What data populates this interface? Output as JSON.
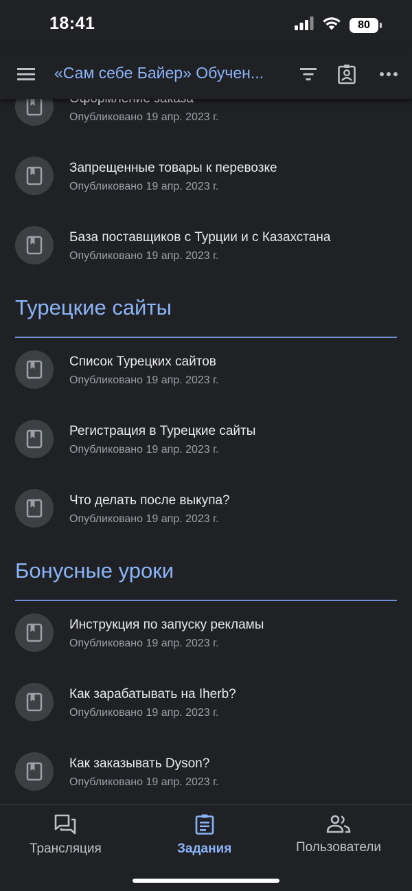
{
  "status_bar": {
    "time": "18:41",
    "battery": "80"
  },
  "app_bar": {
    "title": "«Сам себе Байер» Обучен...",
    "icons": [
      "menu-icon",
      "filter-icon",
      "assignment-ind-icon",
      "more-horiz-icon"
    ]
  },
  "feed": [
    {
      "kind": "item",
      "title": "Оформление заказа",
      "meta": "Опубликовано 19 апр. 2023 г."
    },
    {
      "kind": "item",
      "title": "Запрещенные товары к перевозке",
      "meta": "Опубликовано 19 апр. 2023 г."
    },
    {
      "kind": "item",
      "title": "База поставщиков с Турции и с Казахстана",
      "meta": "Опубликовано 19 апр. 2023 г."
    },
    {
      "kind": "section",
      "title": "Турецкие сайты"
    },
    {
      "kind": "item",
      "title": "Список Турецких сайтов",
      "meta": "Опубликовано 19 апр. 2023 г."
    },
    {
      "kind": "item",
      "title": "Регистрация в Турецкие сайты",
      "meta": "Опубликовано 19 апр. 2023 г."
    },
    {
      "kind": "item",
      "title": "Что делать после выкупа?",
      "meta": "Опубликовано 19 апр. 2023 г."
    },
    {
      "kind": "section",
      "title": "Бонусные уроки"
    },
    {
      "kind": "item",
      "title": "Инструкция по запуску рекламы",
      "meta": "Опубликовано 19 апр. 2023 г."
    },
    {
      "kind": "item",
      "title": "Как зарабатывать на Iherb?",
      "meta": "Опубликовано 19 апр. 2023 г."
    },
    {
      "kind": "item",
      "title": "Как заказывать Dyson?",
      "meta": "Опубликовано 19 апр. 2023 г."
    }
  ],
  "bottom_nav": {
    "items": [
      {
        "label": "Трансляция",
        "icon": "forum-icon",
        "active": false
      },
      {
        "label": "Задания",
        "icon": "assignment-icon",
        "active": true
      },
      {
        "label": "Пользователи",
        "icon": "people-icon",
        "active": false
      }
    ]
  },
  "colors": {
    "background": "#202124",
    "accent": "#8ab4f8",
    "text": "#e8eaed",
    "secondary": "#9aa0a6",
    "avatar": "#3c4043"
  }
}
